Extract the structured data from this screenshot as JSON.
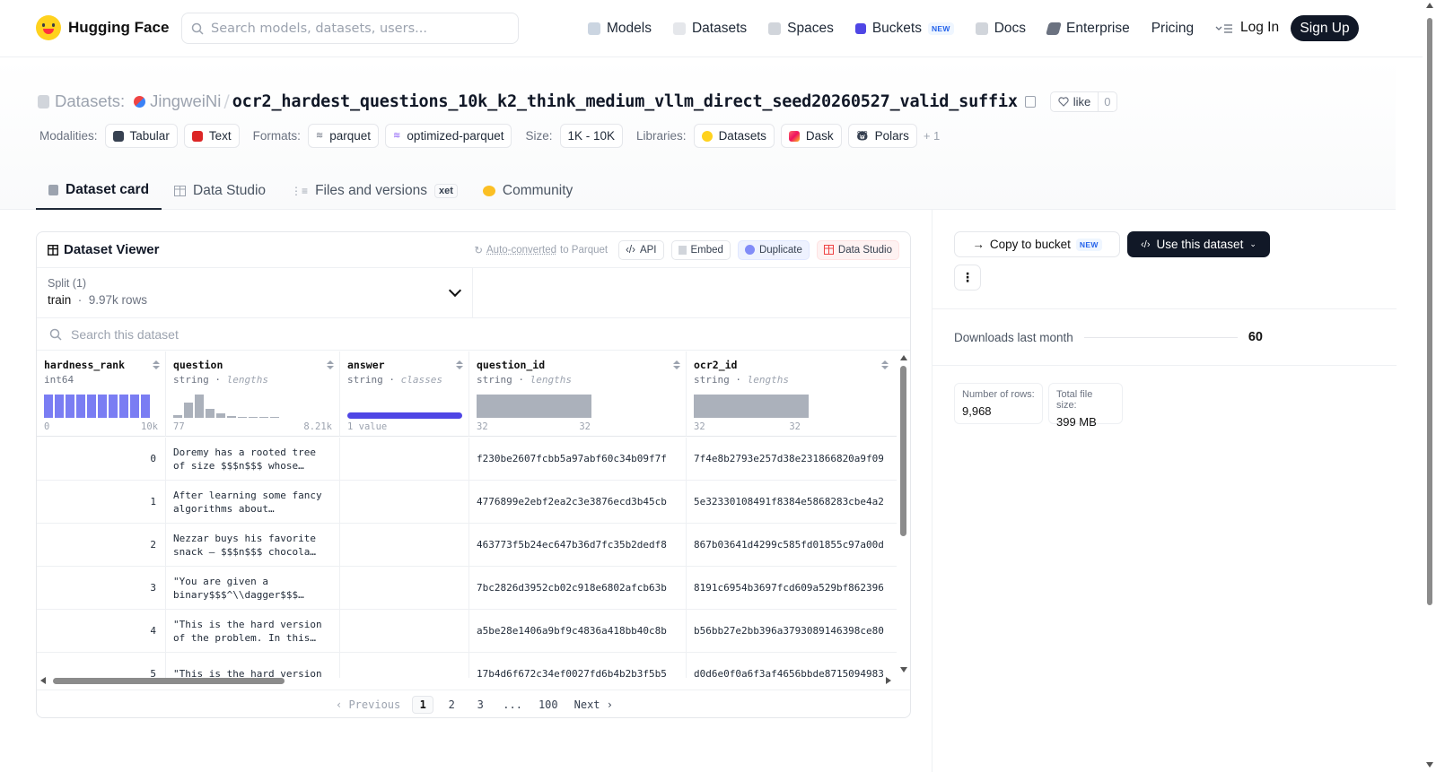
{
  "nav": {
    "brand": "Hugging Face",
    "search_placeholder": "Search models, datasets, users...",
    "links": [
      {
        "label": "Models",
        "icon": "models-icon",
        "color": "#a5b4fc"
      },
      {
        "label": "Datasets",
        "icon": "datasets-icon",
        "color": "#fca5a5"
      },
      {
        "label": "Spaces",
        "icon": "spaces-icon",
        "color": "#86efac"
      },
      {
        "label": "Buckets",
        "icon": "buckets-icon",
        "color": "#4f46e5",
        "badge": "NEW"
      },
      {
        "label": "Docs",
        "icon": "docs-icon",
        "color": "#d1d5db"
      },
      {
        "label": "Enterprise",
        "icon": "enterprise-icon",
        "color": "#6b7280"
      },
      {
        "label": "Pricing"
      }
    ],
    "login": "Log In",
    "signup": "Sign Up"
  },
  "header": {
    "prefix": "Datasets:",
    "owner": "JingweiNi",
    "separator": "/",
    "dataset_name": "ocr2_hardest_questions_10k_k2_think_medium_vllm_direct_seed20260527_valid_suffix",
    "like_label": "like",
    "like_count": "0",
    "modalities_label": "Modalities:",
    "modalities": [
      "Tabular",
      "Text"
    ],
    "formats_label": "Formats:",
    "formats": [
      "parquet",
      "optimized-parquet"
    ],
    "size_label": "Size:",
    "size": "1K - 10K",
    "libraries_label": "Libraries:",
    "libraries": [
      "Datasets",
      "Dask",
      "Polars"
    ],
    "libraries_more": "+ 1"
  },
  "tabs": [
    {
      "label": "Dataset card",
      "active": true
    },
    {
      "label": "Data Studio"
    },
    {
      "label": "Files and versions",
      "badge": "xet"
    },
    {
      "label": "Community"
    }
  ],
  "viewer": {
    "title": "Dataset Viewer",
    "auto_converted": "Auto-converted",
    "auto_to": "to Parquet",
    "actions": [
      "API",
      "Embed",
      "Duplicate",
      "Data Studio"
    ],
    "split_label": "Split (1)",
    "split_value": "train",
    "split_rows": "9.97k rows",
    "search_placeholder": "Search this dataset",
    "columns": [
      {
        "name": "hardness_rank",
        "type": "int64",
        "hint": "",
        "min": "0",
        "max": "10k"
      },
      {
        "name": "question",
        "type": "string",
        "hint": "lengths",
        "min": "77",
        "max": "8.21k"
      },
      {
        "name": "answer",
        "type": "string",
        "hint": "classes",
        "min": "1 value",
        "max": ""
      },
      {
        "name": "question_id",
        "type": "string",
        "hint": "lengths",
        "min": "32",
        "max": "32"
      },
      {
        "name": "ocr2_id",
        "type": "string",
        "hint": "lengths",
        "min": "32",
        "max": "32"
      }
    ],
    "rows": [
      {
        "rank": "0",
        "question": "Doremy has a rooted tree of size $$$n$$$ whose…",
        "answer": "",
        "qid": "f230be2607fcbb5a97abf60c34b09f7f",
        "oid": "7f4e8b2793e257d38e231866820a9f09"
      },
      {
        "rank": "1",
        "question": "After learning some fancy algorithms about…",
        "answer": "",
        "qid": "4776899e2ebf2ea2c3e3876ecd3b45cb",
        "oid": "5e32330108491f8384e5868283cbe4a2"
      },
      {
        "rank": "2",
        "question": "Nezzar buys his favorite snack — $$$n$$$ chocola…",
        "answer": "",
        "qid": "463773f5b24ec647b36d7fc35b2dedf8",
        "oid": "867b03641d4299c585fd01855c97a00d"
      },
      {
        "rank": "3",
        "question": "\"You are given a binary$$$^\\\\dagger$$$…",
        "answer": "",
        "qid": "7bc2826d3952cb02c918e6802afcb63b",
        "oid": "8191c6954b3697fcd609a529bf862396"
      },
      {
        "rank": "4",
        "question": "\"This is the hard version of the problem. In this…",
        "answer": "",
        "qid": "a5be28e1406a9bf9c4836a418bb40c8b",
        "oid": "b56bb27e2bb396a3793089146398ce80"
      },
      {
        "rank": "5",
        "question": "\"This is the hard version",
        "answer": "",
        "qid": "17b4d6f672c34ef0027fd6b4b2b3f5b5",
        "oid": "d0d6e0f0a6f3af4656bbde8715094983"
      }
    ],
    "pager": {
      "prev": "Previous",
      "pages": [
        "1",
        "2",
        "3",
        "...",
        "100"
      ],
      "next": "Next"
    }
  },
  "sidebar": {
    "copy_bucket": "Copy to bucket",
    "copy_badge": "NEW",
    "use_dataset": "Use this dataset",
    "downloads_label": "Downloads last month",
    "downloads_value": "60",
    "rows_label": "Number of rows:",
    "rows_value": "9,968",
    "size_label": "Total file size:",
    "size_value": "399 MB"
  },
  "colors": {
    "accent": "#6366f1",
    "brand_yellow": "#ffd21e",
    "dark_button": "#111827"
  },
  "histograms": {
    "hardness_rank": [
      1,
      1,
      1,
      1,
      1,
      1,
      1,
      1,
      1,
      1
    ],
    "question": [
      0.1,
      0.65,
      1.0,
      0.4,
      0.18,
      0.08,
      0.05,
      0.04,
      0.03,
      0.02
    ]
  }
}
